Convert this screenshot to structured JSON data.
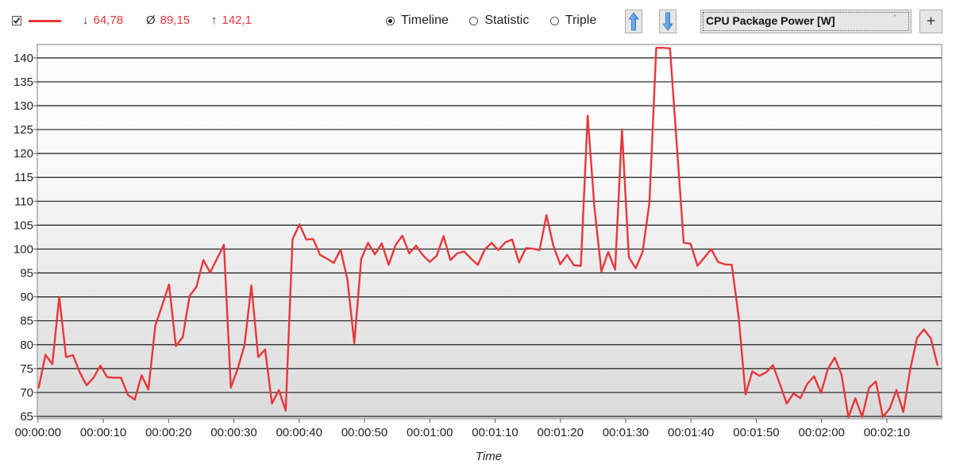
{
  "toolbar": {
    "series_checkbox_checked": true,
    "series_color": "#e8363a",
    "stats": {
      "min_symbol": "↓",
      "min": "64,78",
      "avg_symbol": "Ø",
      "avg": "89,15",
      "max_symbol": "↑",
      "max": "142,1"
    },
    "view_modes": [
      {
        "label": "Timeline",
        "selected": true
      },
      {
        "label": "Statistic",
        "selected": false
      },
      {
        "label": "Triple",
        "selected": false
      }
    ],
    "up_button_icon": "arrow-up-icon",
    "down_button_icon": "arrow-down-icon",
    "sensor_select": "CPU Package Power [W]",
    "add_button": "+"
  },
  "chart_data": {
    "type": "line",
    "title": "",
    "xlabel": "Time",
    "ylabel": "",
    "y_ticks": [
      65,
      70,
      75,
      80,
      85,
      90,
      95,
      100,
      105,
      110,
      115,
      120,
      125,
      130,
      135,
      140
    ],
    "y_tick_labels": [
      "65",
      "70",
      "75",
      "80",
      "85",
      "90",
      "95",
      "100",
      "105",
      "110",
      "115",
      "120",
      "125",
      "130",
      "135",
      "140"
    ],
    "ylim": [
      64.5,
      142.8
    ],
    "x_ticks_seconds": [
      0,
      10,
      20,
      30,
      40,
      50,
      60,
      70,
      80,
      90,
      100,
      110,
      120,
      130
    ],
    "x_tick_labels": [
      "00:00:00",
      "00:00:10",
      "00:00:20",
      "00:00:30",
      "00:00:40",
      "00:00:50",
      "00:01:00",
      "00:01:10",
      "00:01:20",
      "00:01:30",
      "00:01:40",
      "00:01:50",
      "00:02:00",
      "00:02:10"
    ],
    "xlim_seconds": [
      -0.1,
      138.4
    ],
    "grid": true,
    "legend": "none",
    "series": [
      {
        "name": "CPU Package Power [W]",
        "color": "#e8363a",
        "sample_interval_seconds": 1.051,
        "start_seconds": 0.1,
        "values": [
          70.9,
          77.9,
          75.9,
          90.0,
          77.4,
          77.8,
          74.2,
          71.5,
          73.1,
          75.6,
          73.2,
          73.1,
          73.1,
          69.5,
          68.5,
          73.6,
          70.6,
          84.0,
          88.2,
          92.6,
          79.7,
          81.6,
          90.2,
          92.1,
          97.7,
          95.1,
          98.0,
          100.9,
          71.0,
          74.9,
          79.9,
          92.4,
          77.4,
          79.0,
          67.7,
          70.5,
          66.2,
          102.0,
          105.2,
          102.0,
          102.1,
          98.8,
          98.0,
          97.1,
          99.9,
          93.6,
          80.3,
          97.9,
          101.3,
          98.9,
          101.2,
          96.7,
          100.8,
          102.8,
          99.1,
          100.7,
          98.7,
          97.3,
          98.6,
          102.7,
          97.7,
          99.1,
          99.5,
          98.0,
          96.7,
          99.9,
          101.3,
          99.8,
          101.4,
          102.0,
          97.2,
          100.2,
          100.1,
          99.8,
          107.1,
          100.7,
          96.8,
          98.8,
          96.6,
          96.5,
          127.9,
          108.6,
          95.3,
          99.4,
          95.7,
          125.0,
          98.3,
          96.0,
          99.4,
          109.7,
          142.1,
          142.1,
          142.0,
          121.5,
          101.3,
          101.1,
          96.5,
          98.2,
          100.0,
          97.3,
          96.8,
          96.7,
          85.8,
          69.6,
          74.4,
          73.5,
          74.2,
          75.7,
          71.8,
          67.7,
          69.8,
          68.8,
          71.8,
          73.4,
          69.9,
          74.9,
          77.3,
          73.7,
          64.8,
          68.8,
          64.9,
          71.0,
          72.3,
          64.9,
          66.6,
          70.5,
          65.9,
          74.8,
          81.4,
          83.2,
          81.3,
          75.6
        ]
      }
    ]
  }
}
